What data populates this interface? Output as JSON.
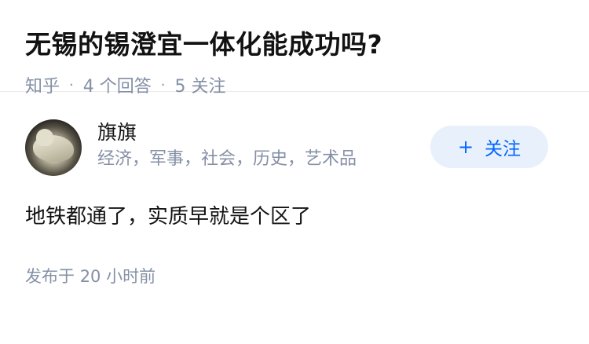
{
  "question": {
    "title": "无锡的锡澄宜一体化能成功吗?",
    "source": "知乎",
    "separator": "·",
    "answers_count": "4",
    "answers_label": "个回答",
    "followers_count": "5",
    "followers_label": "关注"
  },
  "answer": {
    "author_name": "旗旗",
    "author_bio": "经济，军事，社会，历史，艺术品",
    "follow_plus": "+",
    "follow_label": "关注",
    "content": "地铁都通了，实质早就是个区了",
    "published_label": "发布于",
    "published_time": "20 小时前",
    "avatar": "avatar-jade-figure",
    "accent_color": "#0066ff"
  }
}
